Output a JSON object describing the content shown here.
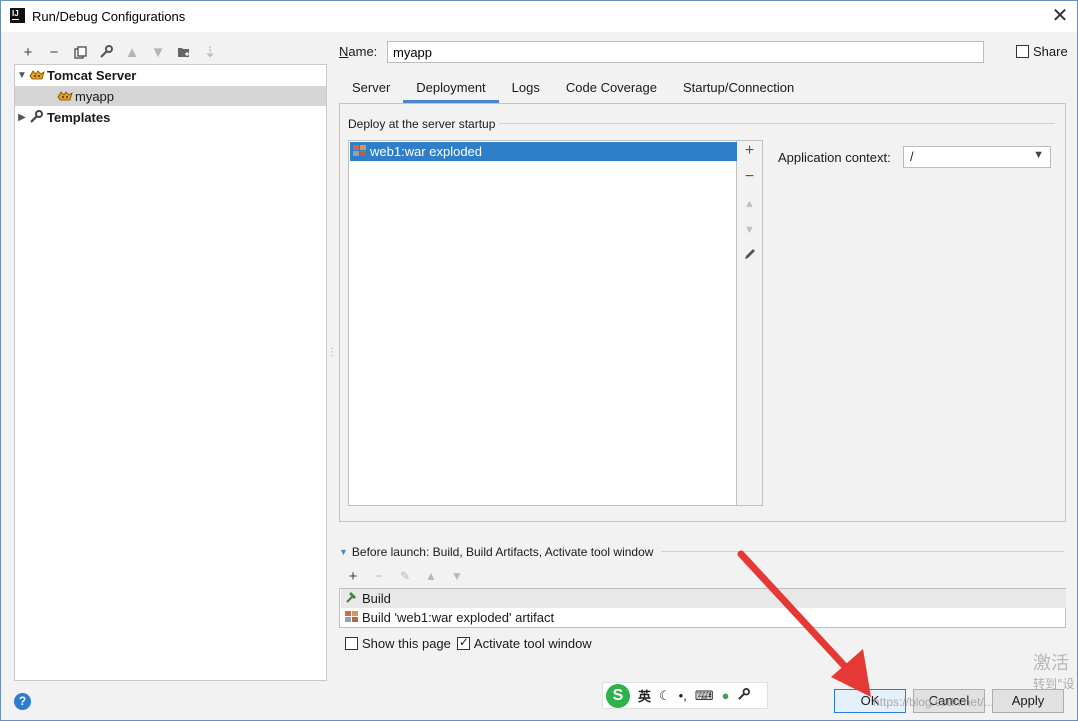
{
  "window": {
    "title": "Run/Debug Configurations",
    "icon": "intellij-icon"
  },
  "tree_toolbar": {
    "icons": [
      "add-icon",
      "remove-icon",
      "copy-icon",
      "wrench-icon",
      "move-up-icon",
      "move-down-icon",
      "folder-icon",
      "sort-icon"
    ]
  },
  "tree": {
    "items": [
      {
        "label": "Tomcat Server",
        "icon": "tomcat-icon",
        "expanded": true
      },
      {
        "label": "myapp",
        "icon": "tomcat-icon",
        "selected": true
      },
      {
        "label": "Templates",
        "icon": "wrench-icon",
        "expanded": false
      }
    ]
  },
  "name": {
    "label_underlined": "N",
    "label_rest": "ame:",
    "value": "myapp"
  },
  "share": {
    "label": "Share",
    "checked": false
  },
  "tabs": [
    {
      "label": "Server"
    },
    {
      "label": "Deployment",
      "active": true
    },
    {
      "label": "Logs"
    },
    {
      "label": "Code Coverage"
    },
    {
      "label": "Startup/Connection"
    }
  ],
  "deployment": {
    "section_title": "Deploy at the server startup",
    "artifacts": [
      {
        "label": "web1:war exploded",
        "selected": true
      }
    ],
    "side_tools": [
      "+",
      "−",
      "▲",
      "▼",
      "pencil-icon"
    ],
    "app_context_label": "Application context:",
    "app_context_value": "/"
  },
  "before_launch": {
    "title": "Before launch: Build, Build Artifacts, Activate tool window",
    "tasks": [
      {
        "label": "Build",
        "icon": "hammer-icon"
      },
      {
        "label": "Build 'web1:war exploded' artifact",
        "icon": "artifact-icon"
      }
    ]
  },
  "options": {
    "show_page": {
      "label": "Show this page",
      "checked": false
    },
    "activate_tool": {
      "label": "Activate tool window",
      "checked": true
    }
  },
  "ime": {
    "logo": "S",
    "lang": "英",
    "items": [
      "moon-icon",
      "punct-icon",
      "keyboard-icon",
      "user-icon",
      "wrench-icon"
    ]
  },
  "buttons": {
    "ok": "OK",
    "cancel": "Cancel",
    "apply": "Apply"
  },
  "watermark": {
    "line1": "激活",
    "line2": "转到\"设",
    "url": "https://blog.csdn.net/..."
  },
  "colors": {
    "selection": "#2e7ec9",
    "tab_underline": "#4a88c7",
    "arrow": "#e53935"
  }
}
